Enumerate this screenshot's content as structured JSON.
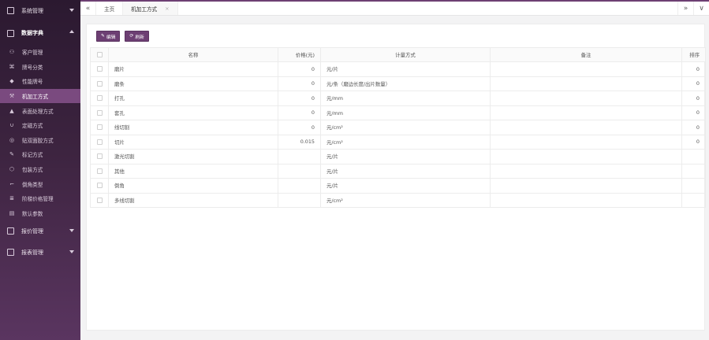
{
  "sidebar": {
    "groups_top": [
      {
        "label": "系统管理",
        "icon": "monitor-icon"
      }
    ],
    "data_dict": {
      "label": "数据字典",
      "icon": "window-icon"
    },
    "items": [
      {
        "label": "客户管理",
        "icon": "users-icon",
        "glyph": "⚇"
      },
      {
        "label": "牌号分类",
        "icon": "grid-icon",
        "glyph": "⌘"
      },
      {
        "label": "性能牌号",
        "icon": "tag-icon",
        "glyph": "◆"
      },
      {
        "label": "机加工方式",
        "icon": "tools-icon",
        "glyph": "⚒"
      },
      {
        "label": "表面处理方式",
        "icon": "flask-icon",
        "glyph": "▲"
      },
      {
        "label": "定磁方式",
        "icon": "magnet-icon",
        "glyph": "∪"
      },
      {
        "label": "贴双面胶方式",
        "icon": "target-icon",
        "glyph": "◎"
      },
      {
        "label": "标记方式",
        "icon": "pen-icon",
        "glyph": "✎"
      },
      {
        "label": "包装方式",
        "icon": "box-icon",
        "glyph": "⬡"
      },
      {
        "label": "倒角类型",
        "icon": "corner-icon",
        "glyph": "⌐"
      },
      {
        "label": "阶梯价格管理",
        "icon": "price-icon",
        "glyph": "≣"
      },
      {
        "label": "默认参数",
        "icon": "settings-icon",
        "glyph": "▤"
      }
    ],
    "groups_bottom": [
      {
        "label": "报价管理",
        "icon": "quote-icon"
      },
      {
        "label": "报表管理",
        "icon": "report-icon"
      }
    ],
    "active_index": 3
  },
  "topbar": {
    "prev_label": "«",
    "next_label": "»",
    "dropdown_label": "∨",
    "tabs": [
      {
        "label": "主页"
      },
      {
        "label": "机加工方式",
        "close": "×"
      }
    ]
  },
  "toolbar": {
    "edit_icon": "✎",
    "edit_label": "编辑",
    "refresh_icon": "⟳",
    "refresh_label": "刷新"
  },
  "table": {
    "headers": {
      "name": "名称",
      "price": "价格(元)",
      "unit": "计量方式",
      "remark": "备注",
      "sort": "排序"
    },
    "rows": [
      {
        "name": "磨片",
        "price": "0",
        "unit": "元/片",
        "remark": "",
        "sort": "0"
      },
      {
        "name": "磨条",
        "price": "0",
        "unit": "元/条（磨边长度/出片数量）",
        "remark": "",
        "sort": "0"
      },
      {
        "name": "打孔",
        "price": "0",
        "unit": "元/mm",
        "remark": "",
        "sort": "0"
      },
      {
        "name": "套孔",
        "price": "0",
        "unit": "元/mm",
        "remark": "",
        "sort": "0"
      },
      {
        "name": "线切割",
        "price": "0",
        "unit": "元/cm²",
        "remark": "",
        "sort": "0"
      },
      {
        "name": "切片",
        "price": "0.015",
        "unit": "元/cm²",
        "remark": "",
        "sort": "0"
      },
      {
        "name": "激光切割",
        "price": "",
        "unit": "元/片",
        "remark": "",
        "sort": ""
      },
      {
        "name": "其他",
        "price": "",
        "unit": "元/片",
        "remark": "",
        "sort": ""
      },
      {
        "name": "倒角",
        "price": "",
        "unit": "元/片",
        "remark": "",
        "sort": ""
      },
      {
        "name": "多线切割",
        "price": "",
        "unit": "元/cm²",
        "remark": "",
        "sort": ""
      }
    ]
  },
  "colors": {
    "accent": "#6d3f73",
    "sidebar_active": "#7a4a7f"
  }
}
